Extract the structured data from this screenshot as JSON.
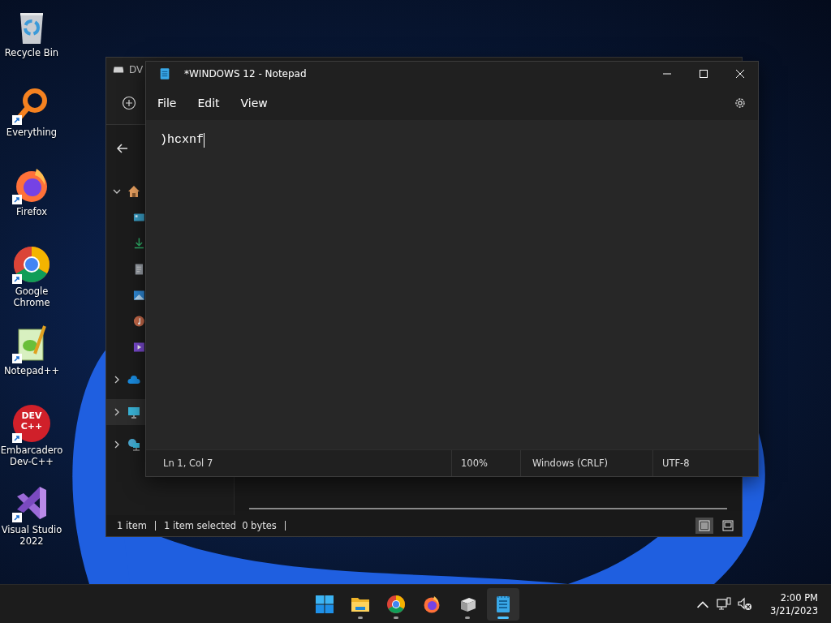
{
  "desktop": {
    "icons": [
      {
        "label": "Recycle Bin",
        "kind": "recycle-bin",
        "shortcut": false
      },
      {
        "label": "Everything",
        "kind": "magnifier",
        "shortcut": true
      },
      {
        "label": "Firefox",
        "kind": "firefox",
        "shortcut": true
      },
      {
        "label": "Google Chrome",
        "kind": "chrome",
        "shortcut": true
      },
      {
        "label": "Notepad++",
        "kind": "notepadpp",
        "shortcut": true
      },
      {
        "label": "Embarcadero Dev-C++",
        "kind": "devcpp",
        "shortcut": true,
        "logo_lines": [
          "DEV",
          "C++"
        ]
      },
      {
        "label": "Visual Studio 2022",
        "kind": "vs",
        "shortcut": true
      }
    ]
  },
  "explorer": {
    "title": "DV",
    "nav": [
      {
        "kind": "home",
        "expanded": true,
        "selected": false,
        "children": [
          {
            "kind": "desktop",
            "selected": false
          },
          {
            "kind": "download",
            "selected": false
          },
          {
            "kind": "document",
            "selected": false
          },
          {
            "kind": "picture",
            "selected": false
          },
          {
            "kind": "music",
            "selected": false
          },
          {
            "kind": "video",
            "selected": false
          }
        ]
      },
      {
        "kind": "cloud",
        "expanded": false,
        "selected": false
      },
      {
        "kind": "pc",
        "expanded": false,
        "selected": true
      },
      {
        "kind": "network",
        "expanded": false,
        "selected": false
      }
    ],
    "status": {
      "count": "1 item",
      "selection": "1 item selected",
      "size": "0 bytes"
    },
    "views": [
      {
        "kind": "details",
        "selected": true
      },
      {
        "kind": "tiles",
        "selected": false
      }
    ]
  },
  "notepad": {
    "title": "*WINDOWS 12 - Notepad",
    "menu": [
      "File",
      "Edit",
      "View"
    ],
    "text": ")hcxnf",
    "status": [
      "Ln 1, Col 7",
      "100%",
      "Windows (CRLF)",
      "UTF-8"
    ]
  },
  "taskbar": {
    "apps": [
      {
        "kind": "start",
        "running": false,
        "active": false
      },
      {
        "kind": "folder",
        "running": true,
        "active": false
      },
      {
        "kind": "chrome",
        "running": true,
        "active": false
      },
      {
        "kind": "firefox",
        "running": false,
        "active": false
      },
      {
        "kind": "drive",
        "running": true,
        "active": false
      },
      {
        "kind": "notepad",
        "running": true,
        "active": true
      }
    ],
    "tray": {
      "time": "2:00 PM",
      "date": "3/21/2023"
    }
  }
}
